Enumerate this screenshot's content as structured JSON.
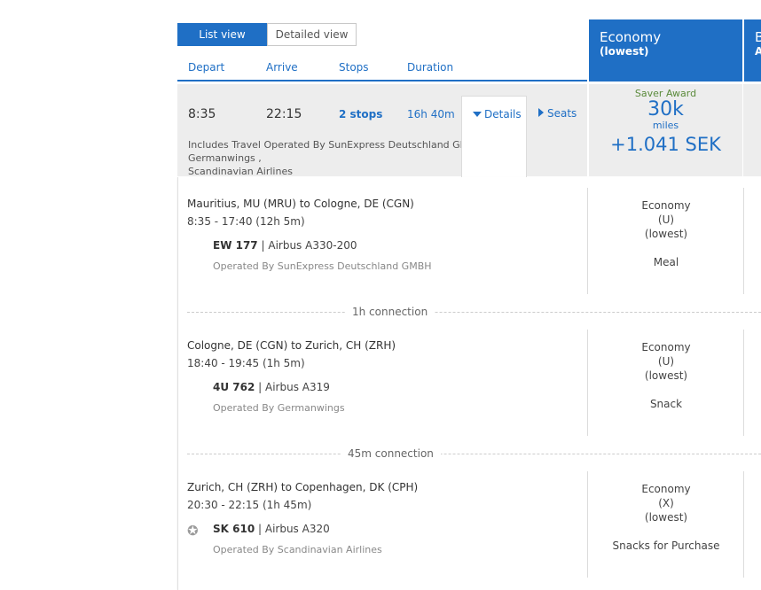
{
  "view_toggle": {
    "list": "List view",
    "detailed": "Detailed view"
  },
  "columns": {
    "depart": "Depart",
    "arrive": "Arrive",
    "stops": "Stops",
    "duration": "Duration"
  },
  "fare_headers": [
    {
      "title": "Economy",
      "sub": "(lowest)"
    },
    {
      "title": "B",
      "sub": "A"
    }
  ],
  "summary": {
    "depart": "8:35",
    "arrive": "22:15",
    "stops": "2 stops",
    "duration": "16h 40m",
    "details": "Details",
    "seats": "Seats",
    "operated_line1": "Includes Travel Operated By SunExpress Deutschland GMBH, Germanwings ,",
    "operated_line2": "Scandinavian Airlines"
  },
  "fare": {
    "label": "Saver Award",
    "miles": "30k",
    "miles_unit": "miles",
    "price": "+1.041 SEK"
  },
  "segments": [
    {
      "route": "Mauritius, MU (MRU) to Cologne, DE (CGN)",
      "time": "8:35 - 17:40 (12h 5m)",
      "flight": "EW 177",
      "aircraft": "| Airbus A330-200",
      "operated": "Operated By SunExpress Deutschland GMBH",
      "cabin": "Economy",
      "code": "(U)",
      "lowest": "(lowest)",
      "meal": "Meal"
    },
    {
      "route": "Cologne, DE (CGN) to Zurich, CH (ZRH)",
      "time": "18:40 - 19:45 (1h 5m)",
      "flight": "4U 762",
      "aircraft": "| Airbus A319",
      "operated": "Operated By Germanwings",
      "cabin": "Economy",
      "code": "(U)",
      "lowest": "(lowest)",
      "meal": "Snack"
    },
    {
      "route": "Zurich, CH (ZRH) to Copenhagen, DK (CPH)",
      "time": "20:30 - 22:15 (1h 45m)",
      "flight": "SK 610",
      "aircraft": "| Airbus A320",
      "operated": "Operated By Scandinavian Airlines",
      "cabin": "Economy",
      "code": "(X)",
      "lowest": "(lowest)",
      "meal": "Snacks for Purchase"
    }
  ],
  "connections": [
    "1h connection",
    "45m connection"
  ],
  "icons": {
    "alliance": "star-alliance-icon"
  }
}
